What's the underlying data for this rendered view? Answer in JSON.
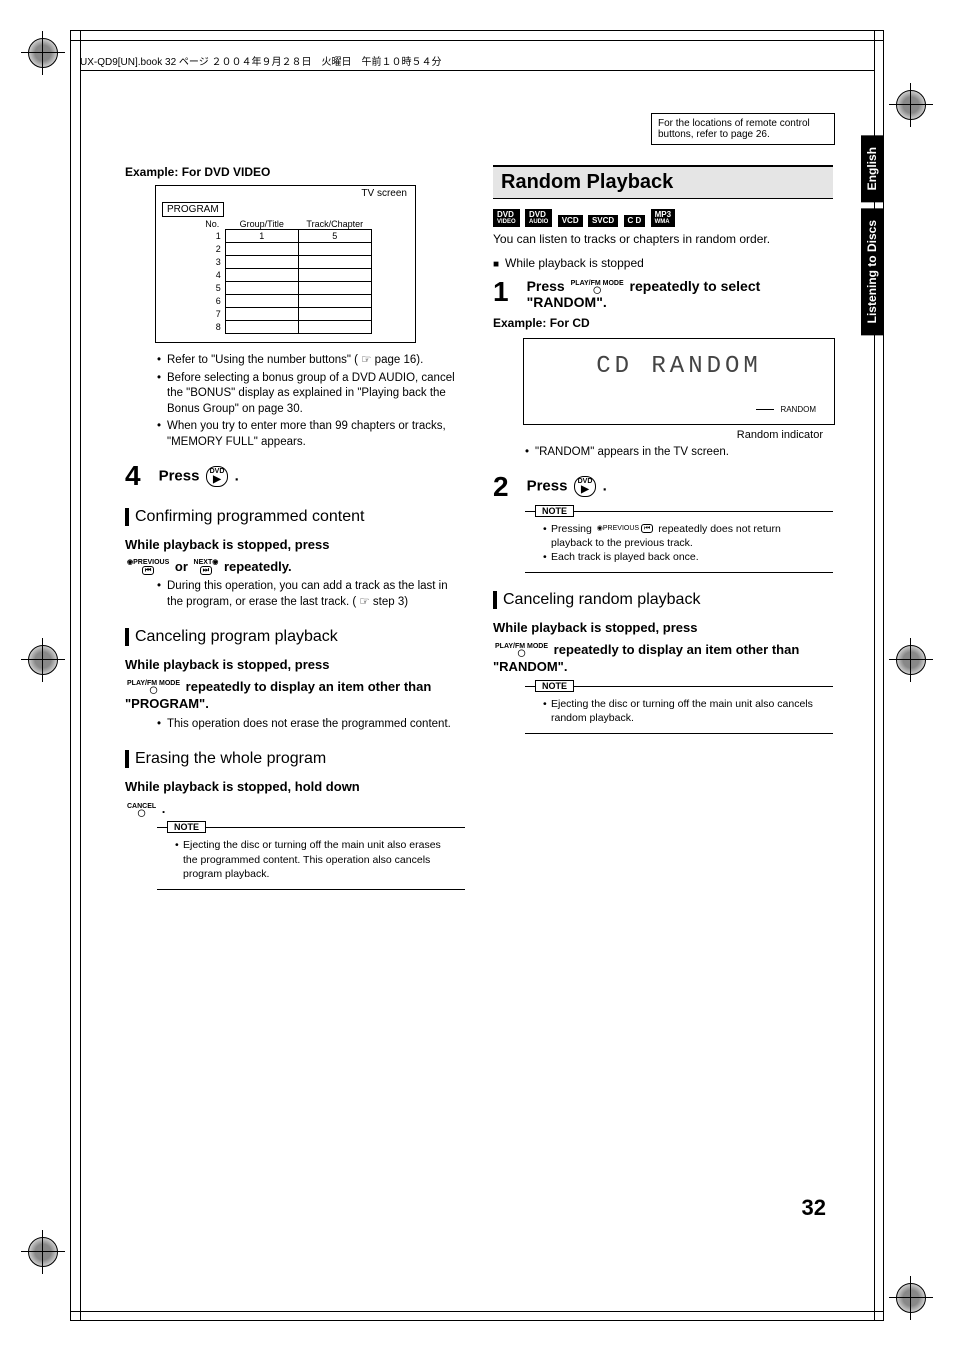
{
  "header": "UX-QD9[UN].book  32 ページ  ２００４年９月２８日　火曜日　午前１０時５４分",
  "info_box": "For the locations of remote control buttons, refer to page 26.",
  "sidebar": {
    "tab1": "English",
    "tab2": "Listening to Discs"
  },
  "left": {
    "example_label": "Example: For DVD VIDEO",
    "tv_label": "TV screen",
    "program_label": "PROGRAM",
    "table": {
      "headers": [
        "No.",
        "Group/Title",
        "Track/Chapter"
      ],
      "rows": [
        {
          "no": "1",
          "gt": "1",
          "tc": "5"
        },
        {
          "no": "2",
          "gt": "",
          "tc": ""
        },
        {
          "no": "3",
          "gt": "",
          "tc": ""
        },
        {
          "no": "4",
          "gt": "",
          "tc": ""
        },
        {
          "no": "5",
          "gt": "",
          "tc": ""
        },
        {
          "no": "6",
          "gt": "",
          "tc": ""
        },
        {
          "no": "7",
          "gt": "",
          "tc": ""
        },
        {
          "no": "8",
          "gt": "",
          "tc": ""
        }
      ]
    },
    "bullets1": [
      "Refer to \"Using the number buttons\" ( ☞ page 16).",
      "Before selecting a bonus group of a DVD AUDIO, cancel the \"BONUS\" display as explained in \"Playing back the Bonus Group\" on page 30.",
      "When you try to enter more than 99 chapters or tracks, \"MEMORY FULL\" appears."
    ],
    "step4_num": "4",
    "step4_text_a": "Press ",
    "step4_btn_top": "DVD",
    "step4_text_b": ".",
    "sub1": "Confirming programmed content",
    "sub1_bold": "While playback is stopped, press",
    "sub1_line2_a": " or ",
    "sub1_line2_b": " repeatedly.",
    "prev_label": "PREVIOUS",
    "next_label": "NEXT",
    "sub1_bullet": "During this operation, you can add a track as the last in the program, or erase the last track. ( ☞ step 3)",
    "sub2": "Canceling program playback",
    "sub2_bold1": "While playback is stopped, press",
    "play_mode_label": "PLAY/FM MODE",
    "sub2_bold2": " repeatedly to display an item other than \"PROGRAM\".",
    "sub2_bullet": "This operation does not erase the programmed content.",
    "sub3": "Erasing the whole program",
    "sub3_bold": "While playback is stopped, hold down",
    "cancel_label": "CANCEL",
    "sub3_period": ".",
    "note_label": "NOTE",
    "note1_bullet": "Ejecting the disc or turning off the main unit also erases the programmed content. This operation also cancels program playback."
  },
  "right": {
    "banner": "Random Playback",
    "badges": [
      "DVD VIDEO",
      "DVD AUDIO",
      "VCD",
      "SVCD",
      "C D",
      "MP3 WMA"
    ],
    "intro": "You can listen to tracks or chapters in random order.",
    "while_stopped": "While playback is stopped",
    "step1_num": "1",
    "step1_a": "Press ",
    "step1_b": " repeatedly to select \"RANDOM\".",
    "example2": "Example: For CD",
    "lcd": "CD RANDOM",
    "random_ind": "RANDOM",
    "caption": "Random indicator",
    "bullet_tv": "\"RANDOM\" appears in the TV screen.",
    "step2_num": "2",
    "step2_a": "Press ",
    "step2_b": ".",
    "note2_b1": "Pressing  ◉PREVIOUS  repeatedly does not return playback to the previous track.",
    "note2_b2": "Each track is played back once.",
    "sub4": "Canceling random playback",
    "sub4_bold1": "While playback is stopped, press",
    "sub4_bold2": " repeatedly to display an item other than \"RANDOM\".",
    "note3_bullet": "Ejecting the disc or turning off the main unit also cancels random playback."
  },
  "page_number": "32"
}
